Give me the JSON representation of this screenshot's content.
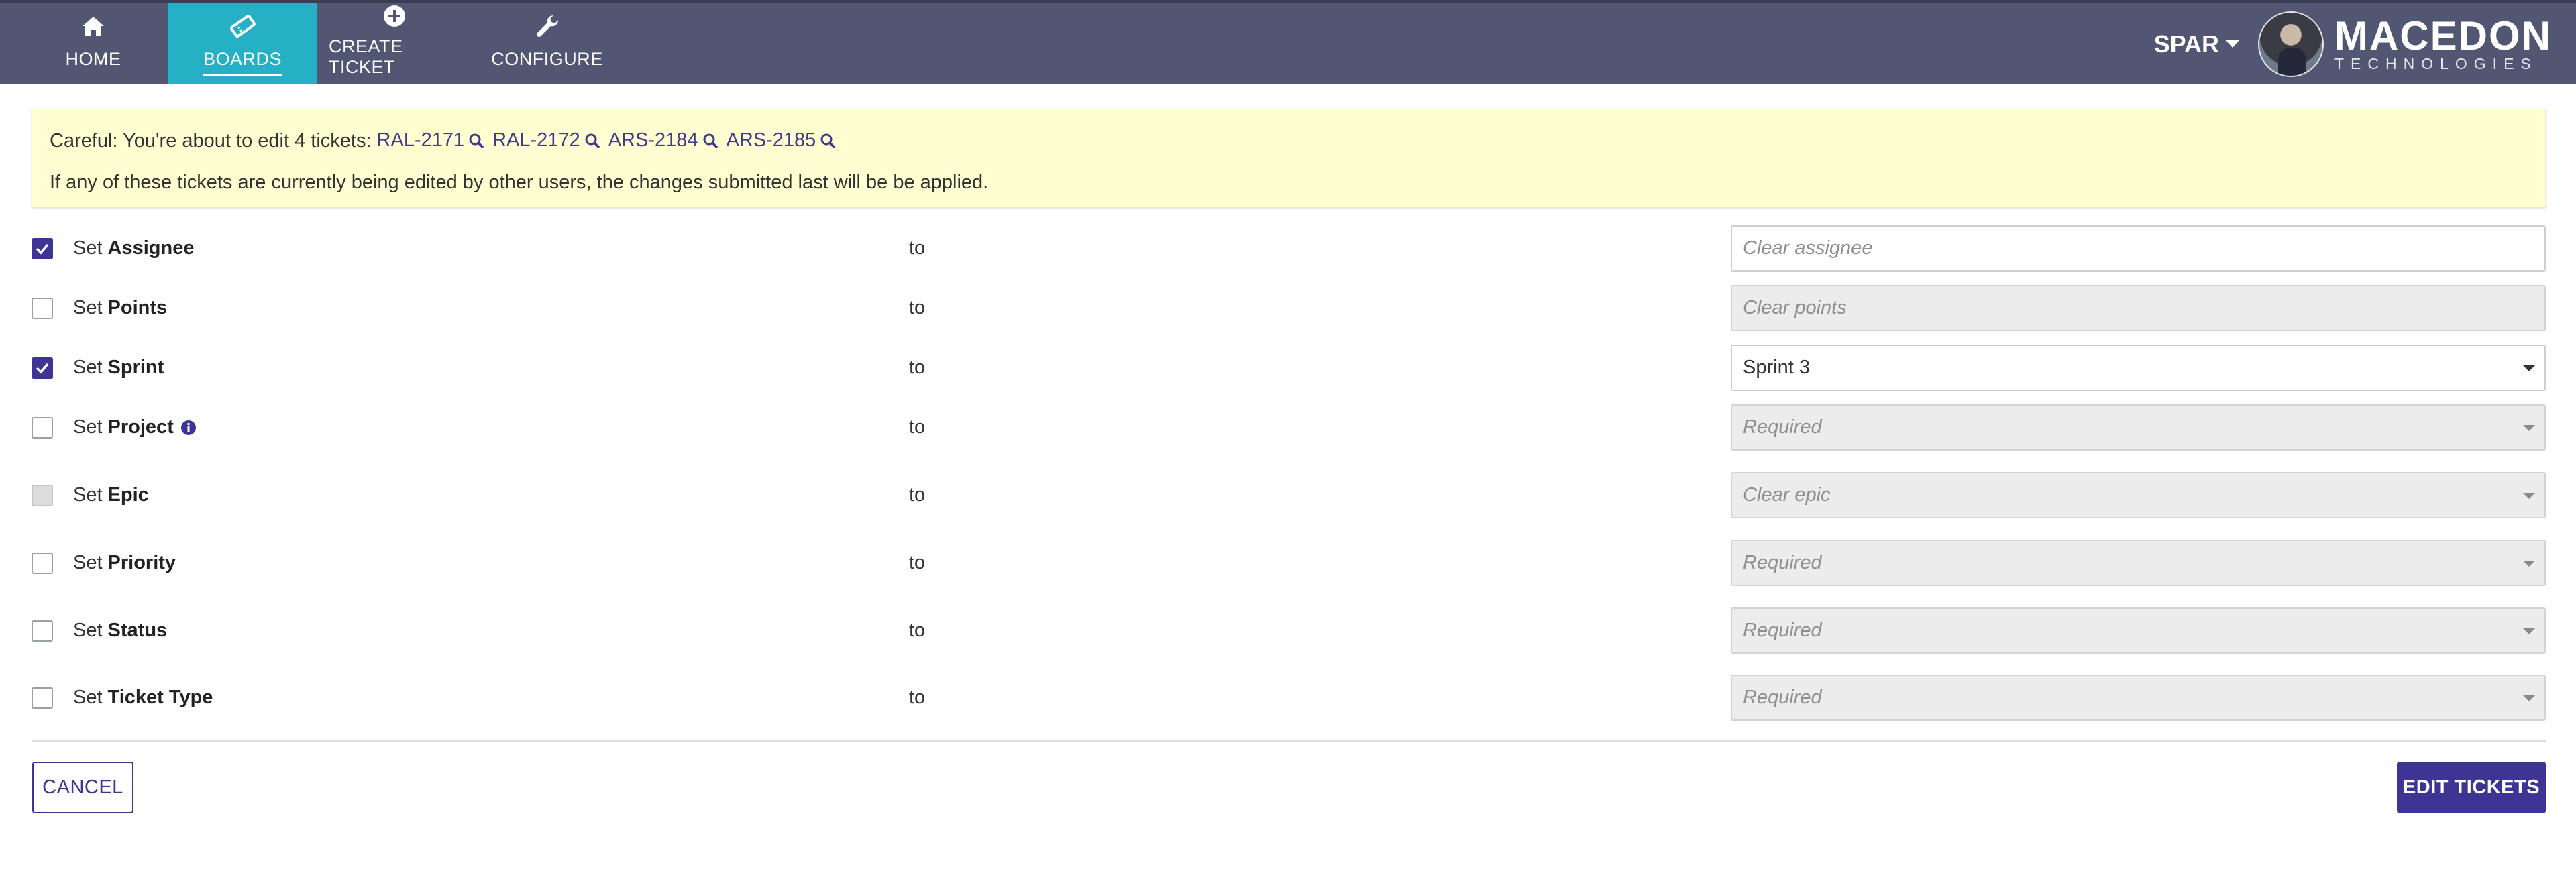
{
  "nav": {
    "items": [
      {
        "label": "HOME",
        "icon": "home-icon"
      },
      {
        "label": "BOARDS",
        "icon": "ticket-icon",
        "active": true
      },
      {
        "label": "CREATE TICKET",
        "icon": "plus-circle-icon"
      },
      {
        "label": "CONFIGURE",
        "icon": "wrench-icon"
      }
    ],
    "org": "SPAR",
    "logo_main": "MACEDON",
    "logo_sub": "TECHNOLOGIES"
  },
  "banner": {
    "prefix": "Careful: You're about to edit 4 tickets:",
    "tickets": [
      "RAL-2171",
      "RAL-2172",
      "ARS-2184",
      "ARS-2185"
    ],
    "note": "If any of these tickets are currently being edited by other users, the changes submitted last will be be applied."
  },
  "form": {
    "set_word": "Set",
    "to_word": "to",
    "rows": [
      {
        "field": "Assignee",
        "checked": true,
        "control": "input",
        "placeholder": "Clear assignee",
        "value": ""
      },
      {
        "field": "Points",
        "checked": false,
        "control": "input",
        "placeholder": "Clear points",
        "value": "",
        "disabled": true
      },
      {
        "field": "Sprint",
        "checked": true,
        "control": "select",
        "placeholder": "",
        "value": "Sprint 3"
      },
      {
        "field": "Project",
        "checked": false,
        "control": "select",
        "placeholder": "Required",
        "value": "",
        "disabled": true,
        "info": true
      },
      {
        "field": "Epic",
        "checked": false,
        "control": "select",
        "placeholder": "Clear epic",
        "value": "",
        "disabled": true,
        "checkbox_disabled": true
      },
      {
        "field": "Priority",
        "checked": false,
        "control": "select",
        "placeholder": "Required",
        "value": "",
        "disabled": true
      },
      {
        "field": "Status",
        "checked": false,
        "control": "select",
        "placeholder": "Required",
        "value": "",
        "disabled": true
      },
      {
        "field": "Ticket Type",
        "checked": false,
        "control": "select",
        "placeholder": "Required",
        "value": "",
        "disabled": true
      }
    ]
  },
  "buttons": {
    "cancel": "CANCEL",
    "submit": "EDIT TICKETS"
  },
  "colors": {
    "nav_bg": "#515672",
    "nav_active": "#25b0c6",
    "primary": "#3d3493",
    "banner_bg": "#ffffd1"
  }
}
